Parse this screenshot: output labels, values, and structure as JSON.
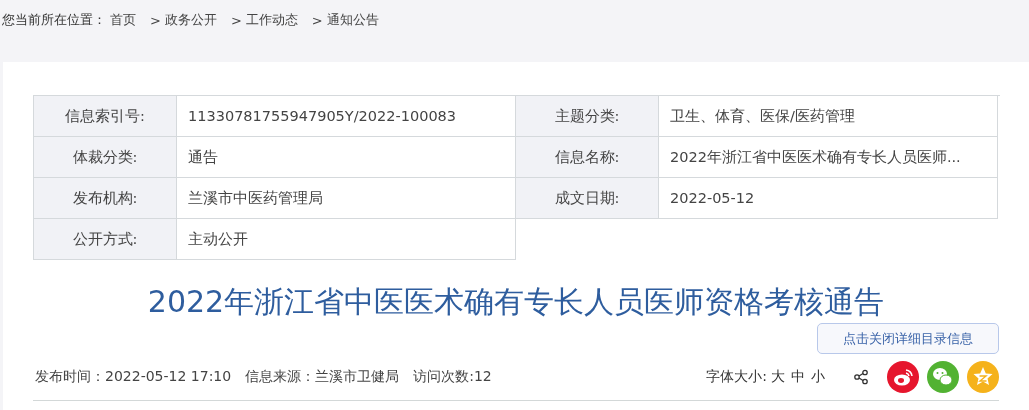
{
  "breadcrumb": {
    "label": "您当前所在位置：",
    "items": [
      {
        "text": "首页"
      },
      {
        "text": "政务公开",
        "separator": ">"
      },
      {
        "text": "工作动态",
        "separator": ">"
      },
      {
        "text": "通知公告",
        "separator": ">"
      }
    ]
  },
  "info_table": {
    "rows": [
      [
        {
          "label": "信息索引号:",
          "value": "11330781755947905Y/2022-100083"
        },
        {
          "label": "主题分类:",
          "value": "卫生、体育、医保/医药管理"
        }
      ],
      [
        {
          "label": "体裁分类:",
          "value": "通告"
        },
        {
          "label": "信息名称:",
          "value": "2022年浙江省中医医术确有专长人员医师..."
        }
      ],
      [
        {
          "label": "发布机构:",
          "value": "兰溪市中医药管理局"
        },
        {
          "label": "成文日期:",
          "value": "2022-05-12"
        }
      ],
      [
        {
          "label": "公开方式:",
          "value": "主动公开"
        }
      ]
    ]
  },
  "title": "2022年浙江省中医医术确有专长人员医师资格考核通告",
  "toggle_button": "点击关闭详细目录信息",
  "meta": [
    "发布时间：2022-05-12 17:10",
    "信息来源：兰溪市卫健局",
    "访问次数:12"
  ],
  "font_size": {
    "label": "字体大小:",
    "options": [
      "大",
      "中",
      "小"
    ]
  },
  "share": [
    {
      "kind": "weibo",
      "color": "#e6162d"
    },
    {
      "kind": "wechat",
      "color": "#52b232"
    },
    {
      "kind": "qzone",
      "color": "#f5b21b"
    }
  ]
}
